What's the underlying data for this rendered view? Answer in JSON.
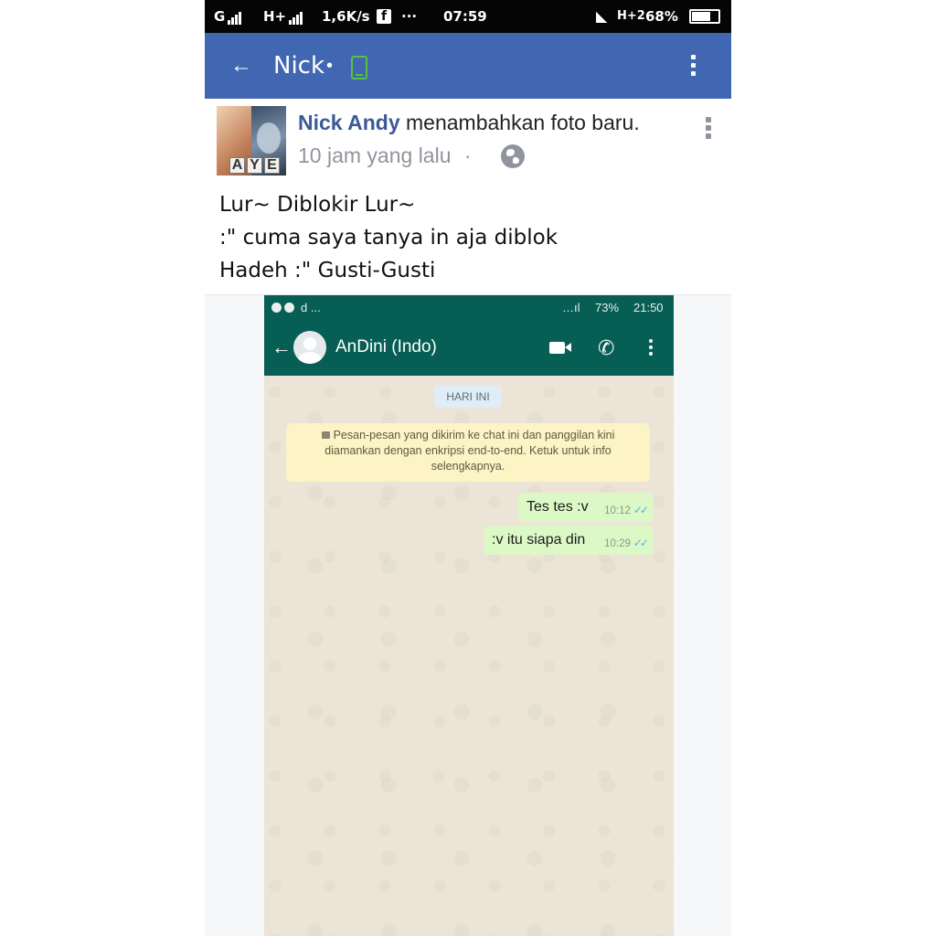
{
  "status_bar": {
    "network_left": "G",
    "network_mid": "H+",
    "speed": "1,6K/s",
    "app_icon": "f",
    "more": "···",
    "time": "07:59",
    "network_right": "H+2",
    "battery": "68%"
  },
  "fb_header": {
    "back_icon": "←",
    "title": "Nick",
    "separator": "•"
  },
  "post": {
    "author": "Nick Andy",
    "action": "menambahkan foto baru.",
    "time": "10 jam yang lalu",
    "time_separator": "·",
    "avatar_letters": [
      "A",
      "Y",
      "E"
    ],
    "text_lines": [
      "Lur~ Diblokir Lur~",
      ":\" cuma saya tanya in aja diblok",
      "Hadeh :\" Gusti-Gusti"
    ]
  },
  "whatsapp": {
    "status_left": "d ...",
    "status_signal": "…ıl",
    "battery": "73%",
    "time": "21:50",
    "back_icon": "←",
    "contact": "AnDini (Indo)",
    "call_icon": "✆",
    "date_badge": "HARI INI",
    "notice_lines": [
      "Pesan-pesan yang dikirim ke chat ini dan panggilan kini",
      "diamankan dengan enkripsi end-to-end. Ketuk untuk info",
      "selengkapnya."
    ],
    "messages": [
      {
        "text": "Tes tes :v",
        "time": "10:12",
        "ticks": "✓✓"
      },
      {
        "text": ":v itu siapa din",
        "time": "10:29",
        "ticks": "✓✓"
      }
    ],
    "colors": {
      "header": "#075e54",
      "outgoing_bubble": "#dcf8c6",
      "notice": "#fcf4c4",
      "chat_bg": "#ebe4d7"
    }
  },
  "colors": {
    "fb_blue": "#4267b2",
    "author_link": "#3b5998",
    "online_phone": "#57c33a"
  },
  "icons": {
    "fb_more": "vertical-ellipsis-icon",
    "post_globe": "globe-icon",
    "online": "mobile-phone-icon",
    "wa_video": "video-camera-icon",
    "wa_call": "phone-icon",
    "wa_lock": "lock-icon"
  }
}
